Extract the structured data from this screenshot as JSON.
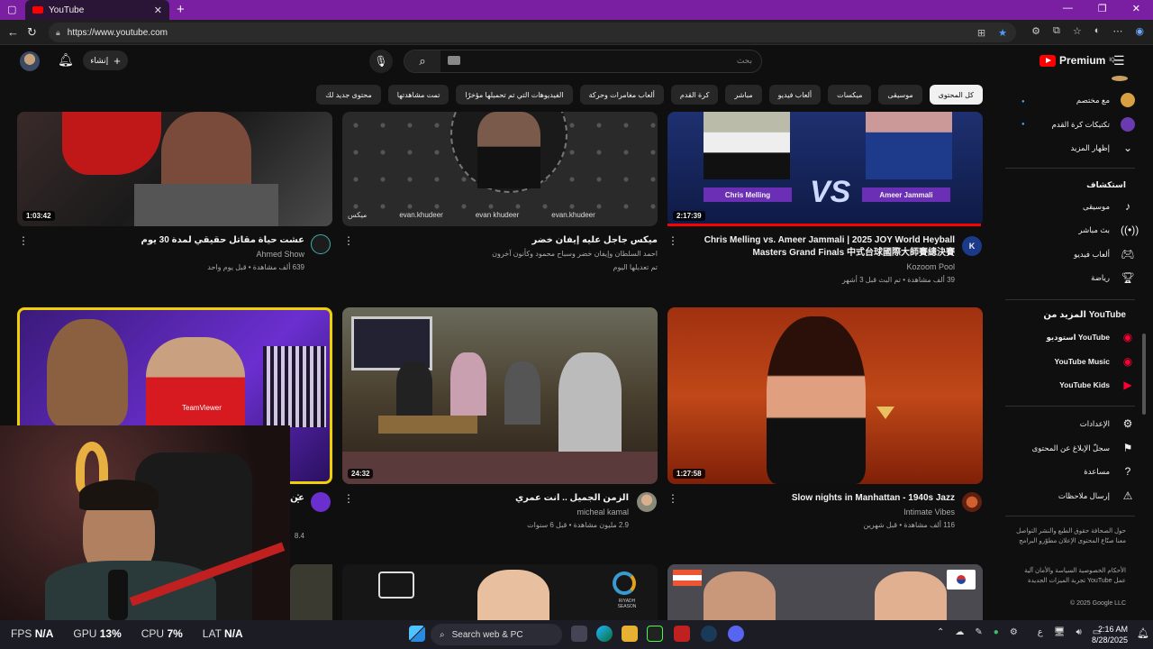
{
  "browser": {
    "tab_title": "YouTube",
    "tab_close": "✕",
    "new_tab": "+",
    "url": "https://www.youtube.com",
    "win_min": "—",
    "win_max": "❐",
    "win_close": "✕"
  },
  "yt": {
    "create_label": "إنشاء",
    "search_placeholder": "بحث",
    "logo_text": "Premium",
    "logo_cc": "IQ"
  },
  "chips": [
    "كل المحتوى",
    "موسيقى",
    "ميكسات",
    "ألعاب فيديو",
    "مباشر",
    "كرة القدم",
    "ألعاب مغامرات وحركة",
    "الفيديوهات التي تم تحميلها مؤخرًا",
    "تمت مشاهدتها",
    "محتوى جديد لك"
  ],
  "videos": [
    {
      "title": "عشت حياة مقاتل حقيقي لمدة 30 يوم",
      "channel": "Ahmed Show",
      "meta": "639 ألف مشاهدة • قبل يوم واحد",
      "duration": "1:03:42"
    },
    {
      "title": "ميكس جاجل عليه إيفان خضر",
      "channel": "احمد السلطان وإيفان خضر وسباح محمود وكأنون آخرون",
      "meta": "تم تعديلها اليوم",
      "duration": ""
    },
    {
      "title": "Chris Melling vs. Ameer Jammali | 2025 JOY World Heyball Masters Grand Finals 中式台球國際大師賽總決賽",
      "channel": "Kozoom Pool",
      "meta": "39 ألف مشاهدة • تم البث قبل 3 أشهر",
      "duration": "2:17:39"
    },
    {
      "title": "عن",
      "channel": "",
      "meta": "8.4",
      "duration": ""
    },
    {
      "title": "الزمن الجميل .. انت عمري",
      "channel": "micheal kamal",
      "meta": "2.9 مليون مشاهدة • قبل 6 سنوات",
      "duration": "24:32"
    },
    {
      "title": "Slow nights in Manhattan - 1940s Jazz",
      "channel": "Intimate Vibes",
      "meta": "116 ألف مشاهدة • قبل شهرين",
      "duration": "1:27:58"
    }
  ],
  "thumb_text": {
    "player_left": "Chris Melling",
    "player_right": "Ameer Jammali",
    "vs": "VS",
    "social_1": "evan.khudeer",
    "social_2": "evan khudeer",
    "social_3": "evan.khudeer",
    "social_4": "ميكس",
    "teamviewer": "TeamViewer",
    "riyadh": "RIYADH SEASON",
    "kozoom_logo": "K"
  },
  "sidebar": {
    "sub_items": [
      "مع مختصم",
      "تكتيكات كرة القدم"
    ],
    "show_more": "إظهار المزيد",
    "explore_title": "استكشاف",
    "explore": [
      "موسيقى",
      "بث مباشر",
      "ألعاب فيديو",
      "رياضة"
    ],
    "more_title": "المزيد من YouTube",
    "more": [
      "استوديو YouTube",
      "YouTube Music",
      "YouTube Kids"
    ],
    "settings": [
      "الإعدادات",
      "سجلّ الإبلاغ عن المحتوى",
      "مساعدة",
      "إرسال ملاحظات"
    ],
    "footer1": "حول  الصحافة  حقوق الطبع والنشر  التواصل معنا  صنّاع المحتوى  الإعلان  مطوّرو البرامج",
    "footer2": "الأحكام  الخصوصية  السياسة والأمان  آلية عمل YouTube  تجربة الميزات الجديدة",
    "copyright": "© 2025 Google LLC"
  },
  "taskbar": {
    "fps_k": "FPS",
    "fps_v": "N/A",
    "gpu_k": "GPU",
    "gpu_v": "13%",
    "cpu_k": "CPU",
    "cpu_v": "7%",
    "lat_k": "LAT",
    "lat_v": "N/A",
    "search": "Search web & PC",
    "time": "2:16 AM",
    "date": "8/28/2025",
    "lang": "ع"
  },
  "colors": {
    "yt_red": "#ff0000",
    "titlebar_purple": "#7b1fa2",
    "highlight_yellow": "#f0d000"
  }
}
